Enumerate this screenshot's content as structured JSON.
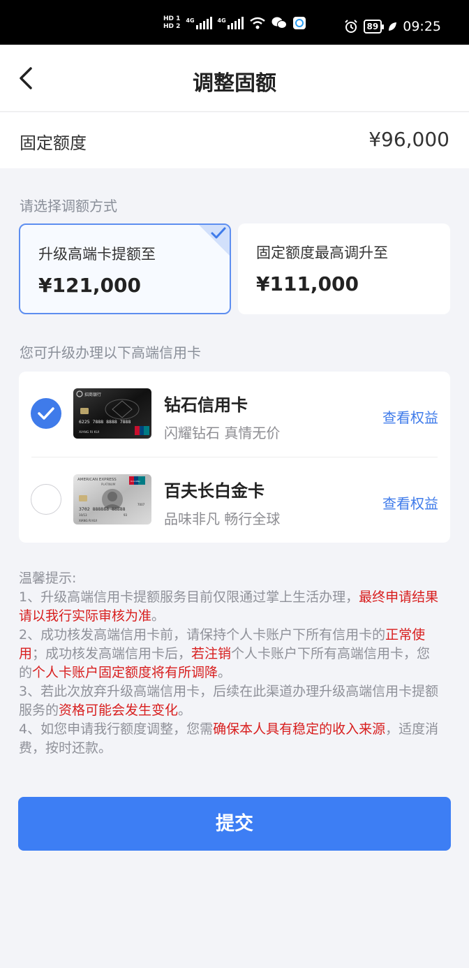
{
  "status_bar": {
    "hd1": "HD 1",
    "hd2": "HD 2",
    "net1": "4G",
    "net2": "4G",
    "battery": "89",
    "time": "09:25"
  },
  "nav": {
    "title": "调整固额"
  },
  "fixed": {
    "label": "固定额度",
    "value": "¥96,000"
  },
  "choose_label": "请选择调额方式",
  "options": [
    {
      "title": "升级高端卡提额至",
      "amount": "¥121,000",
      "selected": true
    },
    {
      "title": "固定额度最高调升至",
      "amount": "¥111,000",
      "selected": false
    }
  ],
  "cards_label": "您可升级办理以下高端信用卡",
  "cards": [
    {
      "name": "钻石信用卡",
      "desc": "闪耀钻石 真情无价",
      "link": "查看权益",
      "selected": true
    },
    {
      "name": "百夫长白金卡",
      "desc": "品味非凡 畅行全球",
      "link": "查看权益",
      "selected": false
    }
  ],
  "card_art": {
    "diamond_bank": "招商银行",
    "diamond_number": "6225 7888 8888 7888",
    "diamond_holder": "XIANG RI KUI",
    "centurion_brand": "AMERICAN EXPRESS",
    "centurion_tier": "PLATINUM",
    "centurion_number": "3702 888888 88888",
    "centurion_holder": "XIANG RI KUI",
    "centurion_date": "10/13",
    "centurion_code": "93",
    "centurion_code2": "7007",
    "unionpay": "UnionPay"
  },
  "tips": {
    "heading": "温馨提示:",
    "p1a": "1、升级高端信用卡提额服务目前仅限通过掌上生活办理，",
    "p1b": "最终申请结果请以我行实际审核为准",
    "p1c": "。",
    "p2a": "2、成功核发高端信用卡前，请保持个人卡账户下所有信用卡的",
    "p2b": "正常使用",
    "p2c": "；成功核发高端信用卡后，",
    "p2d": "若注销",
    "p2e": "个人卡账户下所有高端信用卡，您的",
    "p2f": "个人卡账户固定额度将有所调降",
    "p2g": "。",
    "p3a": "3、若此次放弃升级高端信用卡，后续在此渠道办理升级高端信用卡提额服务的",
    "p3b": "资格可能会发生变化",
    "p3c": "。",
    "p4a": "4、如您申请我行额度调整，您需",
    "p4b": "确保本人具有稳定的收入来源",
    "p4c": "，适度消费，按时还款。"
  },
  "submit_label": "提交",
  "colors": {
    "primary": "#3d7ef4",
    "warning": "#d81e1e",
    "muted": "#8f9199"
  }
}
